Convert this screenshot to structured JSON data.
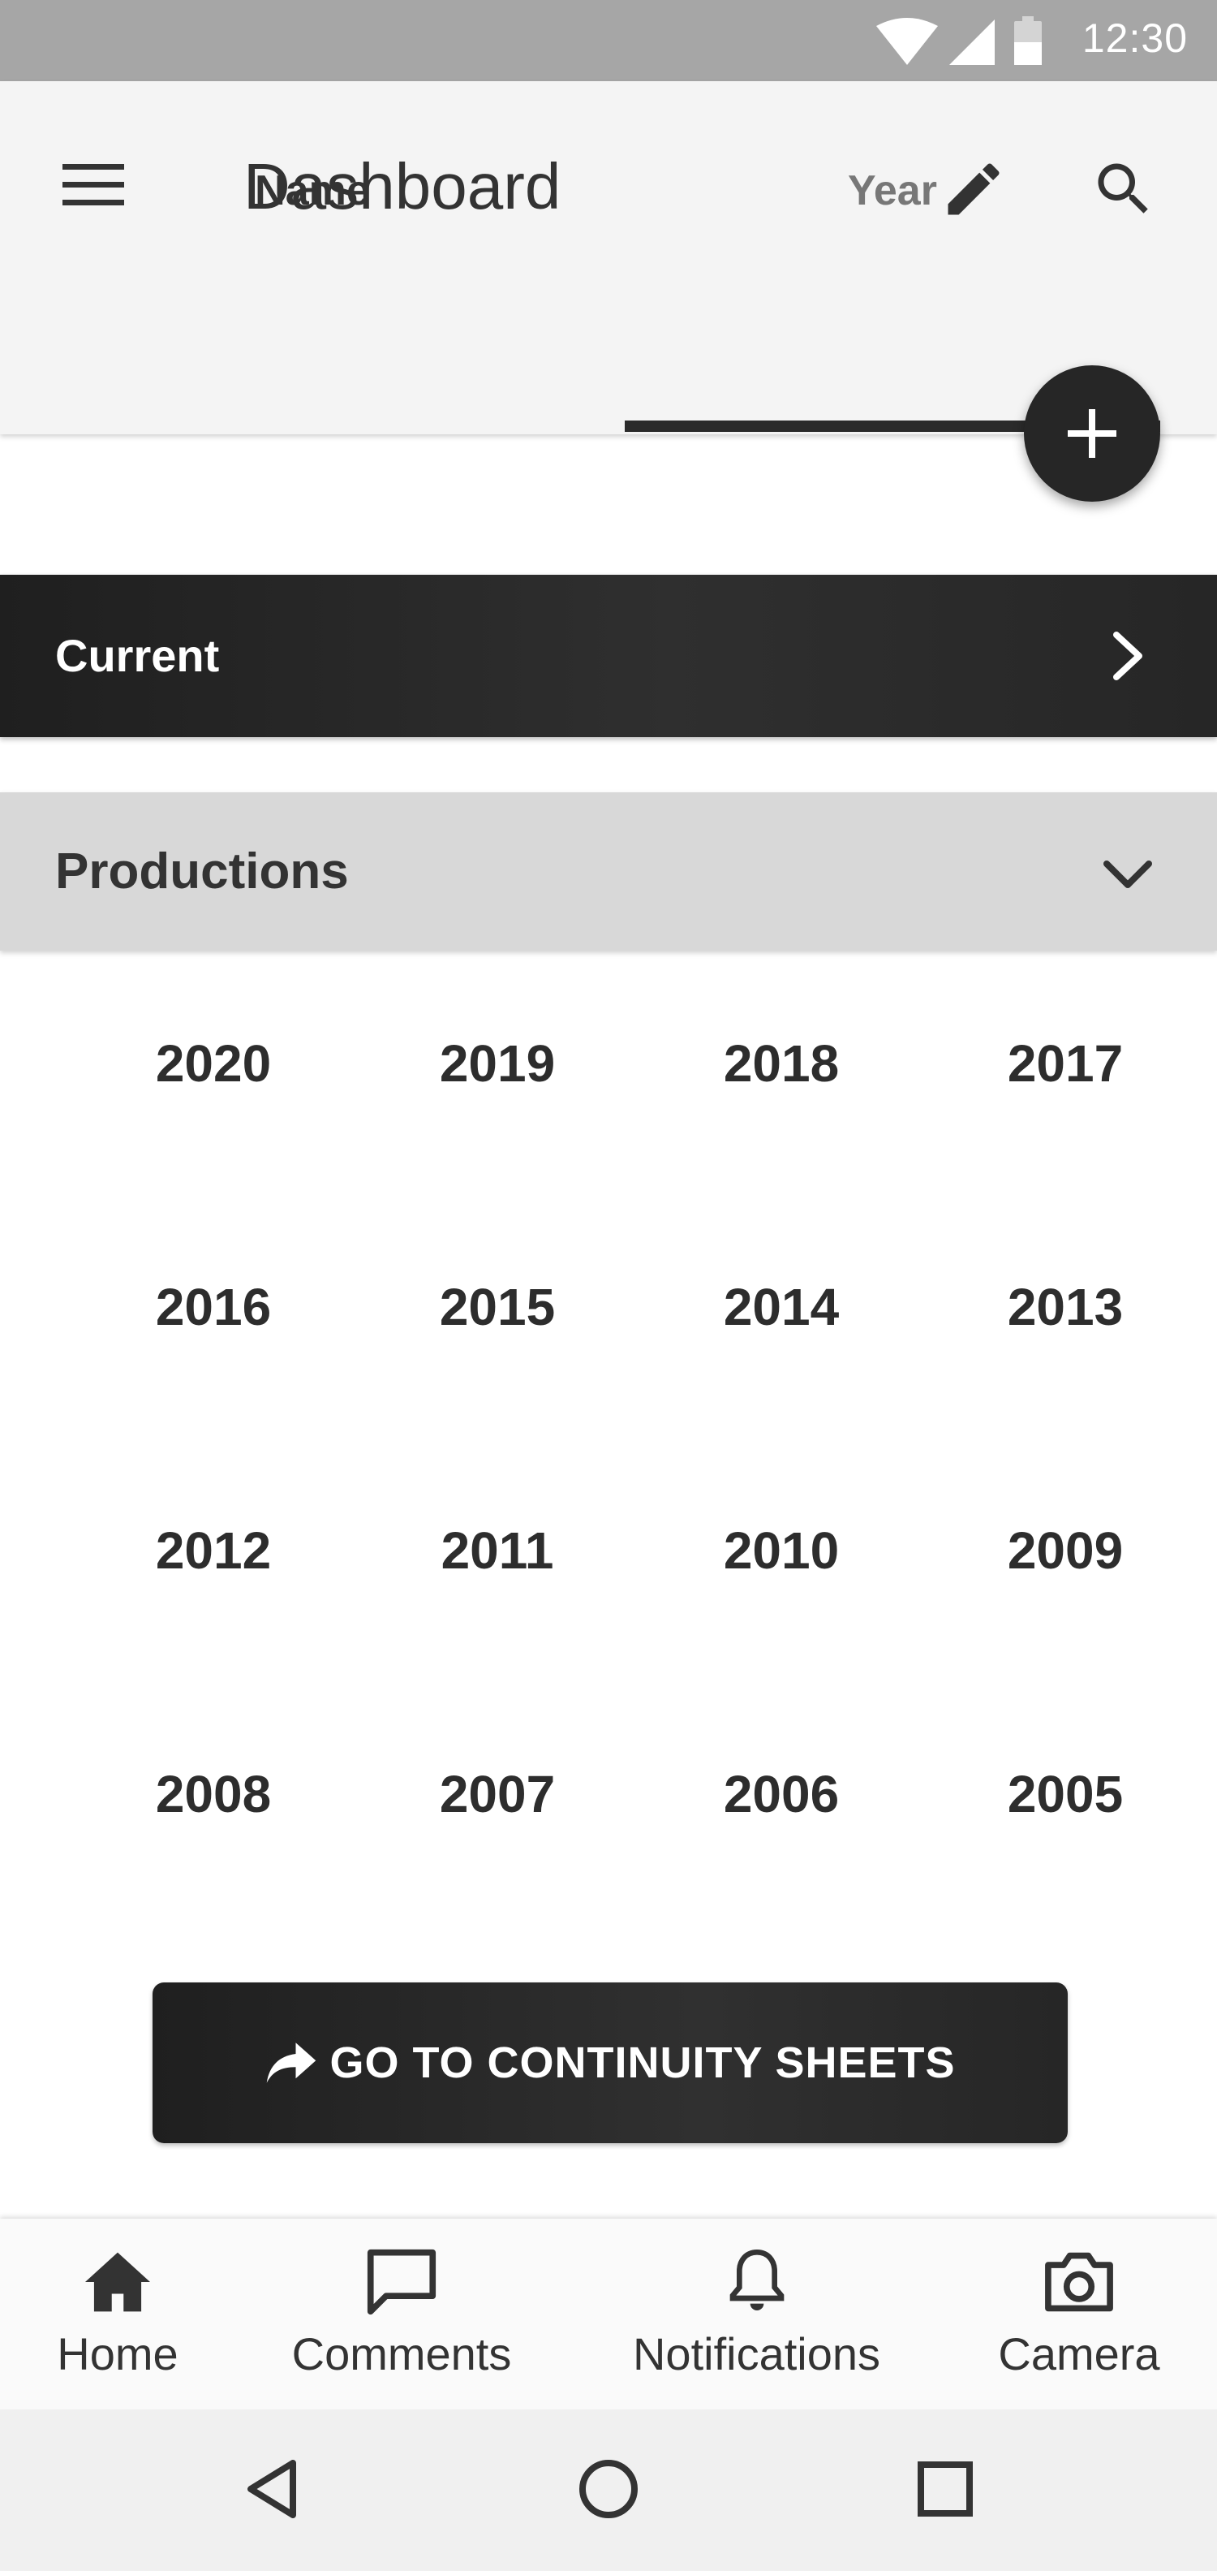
{
  "status_bar": {
    "time": "12:30"
  },
  "app_bar": {
    "title": "Dashboard"
  },
  "tabs": [
    {
      "label": "Name",
      "selected": false
    },
    {
      "label": "Year",
      "selected": true
    }
  ],
  "current": {
    "label": "Current"
  },
  "productions": {
    "label": "Productions",
    "years": [
      "2020",
      "2019",
      "2018",
      "2017",
      "2016",
      "2015",
      "2014",
      "2013",
      "2012",
      "2011",
      "2010",
      "2009",
      "2008",
      "2007",
      "2006",
      "2005"
    ]
  },
  "continuity_button": {
    "label": "GO TO CONTINUITY SHEETS"
  },
  "bottom_nav": [
    {
      "label": "Home",
      "icon": "home-icon"
    },
    {
      "label": "Comments",
      "icon": "comment-icon"
    },
    {
      "label": "Notifications",
      "icon": "bell-icon"
    },
    {
      "label": "Camera",
      "icon": "camera-icon"
    }
  ],
  "colors": {
    "dark": "#262626",
    "tab_indicator": "#2b2b2b",
    "status_bar": "#a6a6a6"
  }
}
